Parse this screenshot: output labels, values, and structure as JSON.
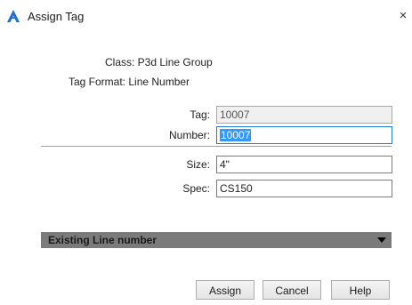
{
  "window": {
    "title": "Assign Tag",
    "close_label": "×"
  },
  "info": {
    "class_line": "Class: P3d Line Group",
    "tag_format_line": "Tag Format: Line Number"
  },
  "form": {
    "tag_label": "Tag:",
    "tag_value": "10007",
    "number_label": "Number:",
    "number_value": "10007",
    "size_label": "Size:",
    "size_value": "4\"",
    "spec_label": "Spec:",
    "spec_value": "CS150"
  },
  "dropdown": {
    "label": "Existing Line number"
  },
  "buttons": {
    "assign": "Assign",
    "cancel": "Cancel",
    "help": "Help"
  },
  "colors": {
    "focus_border": "#1c7cd6",
    "selection": "#3399ff",
    "dropdown_bg": "#7b7b7b",
    "app_icon": "#1f6fd1"
  },
  "icons": {
    "app": "autocad-a-icon",
    "close": "close-icon",
    "dropdown": "chevron-down-icon"
  }
}
